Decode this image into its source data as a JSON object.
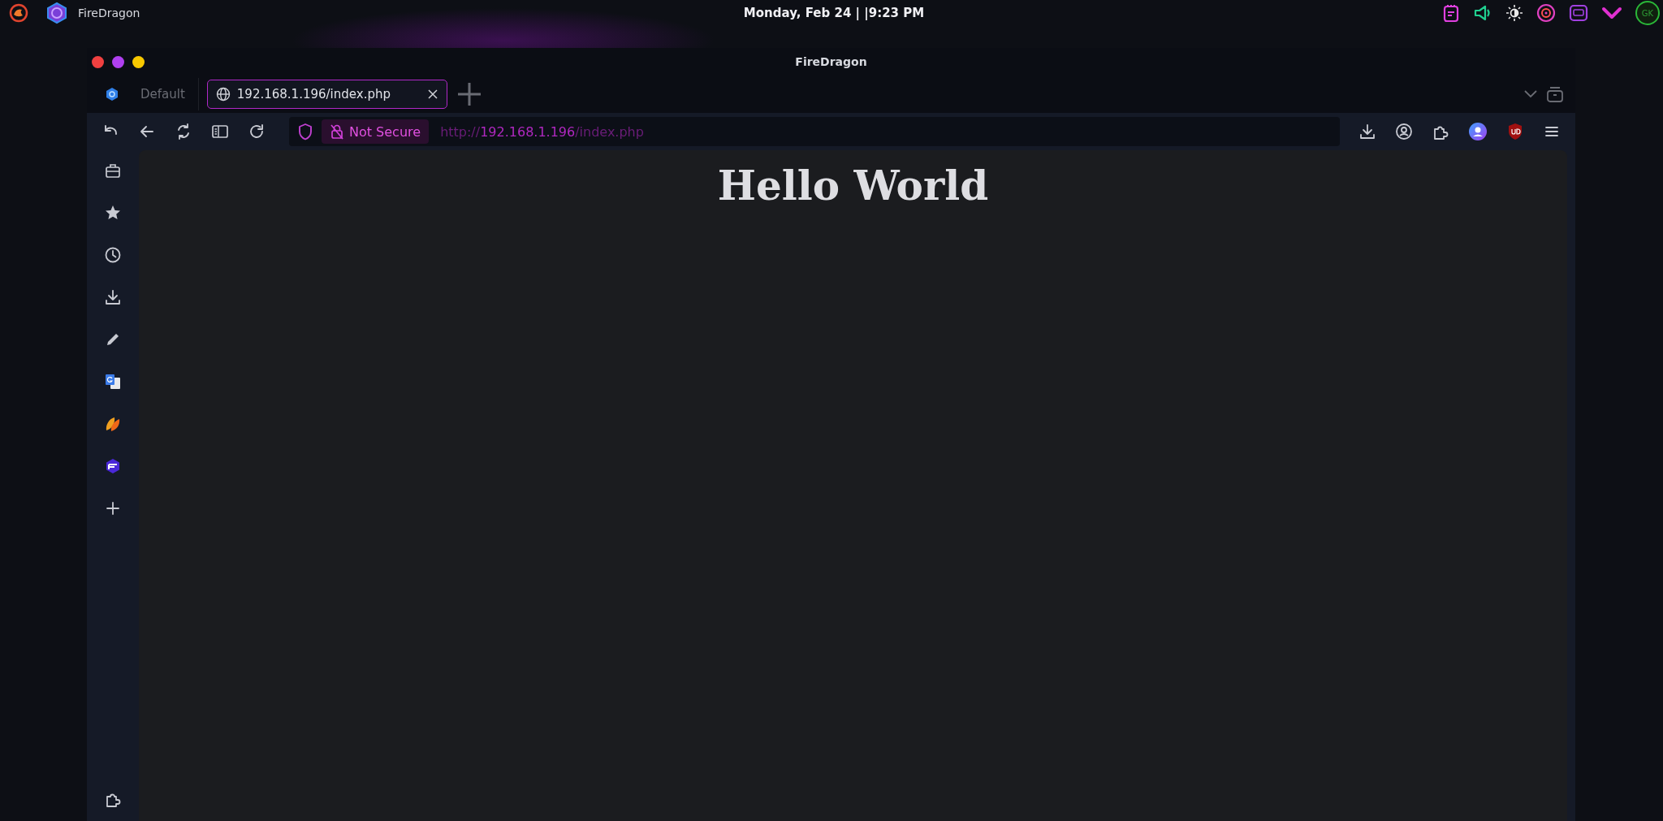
{
  "top_panel": {
    "app_name": "FireDragon",
    "clock": "Monday, Feb 24 | |9:23 PM",
    "avatar": "GK"
  },
  "window": {
    "title": "FireDragon"
  },
  "tabs": [
    {
      "label": "Default",
      "kind": "group",
      "selected": false
    },
    {
      "label": "192.168.1.196/index.php",
      "kind": "page",
      "selected": true
    }
  ],
  "address_bar": {
    "security_badge": "Not Secure",
    "url_scheme": "http://",
    "url_host": "192.168.1.196",
    "url_path": "/index.php"
  },
  "page": {
    "heading": "Hello World"
  }
}
